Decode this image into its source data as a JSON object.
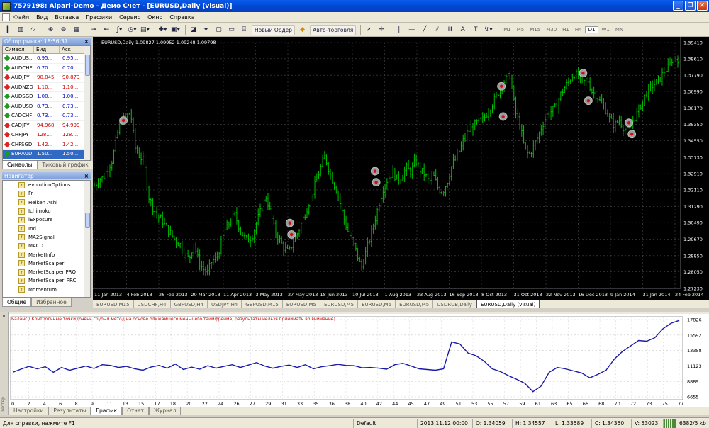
{
  "window": {
    "title": "7579198: Alpari-Demo - Демо Счет - [EURUSD,Daily (visual)]",
    "buttons": [
      "_",
      "❐",
      "✕"
    ]
  },
  "menu": [
    "Файл",
    "Вид",
    "Вставка",
    "Графики",
    "Сервис",
    "Окно",
    "Справка"
  ],
  "toolbar": {
    "new_order": "Новый Ордер",
    "auto_trading": "Авто-торговля",
    "timeframes": [
      "M1",
      "M5",
      "M15",
      "M30",
      "H1",
      "H4",
      "D1",
      "W1",
      "MN"
    ],
    "active_timeframe": "D1",
    "icons": [
      "bar-chart-icon",
      "candle-chart-icon",
      "line-chart-icon",
      "zoom-in-icon",
      "zoom-out-icon",
      "tile-icon",
      "autoscroll-icon",
      "shift-icon",
      "indicators-icon",
      "periods-icon",
      "templates-icon",
      "new-chart-icon",
      "profiles-icon",
      "market-watch-icon",
      "navigator-icon",
      "data-window-icon",
      "terminal-icon",
      "tester-icon"
    ]
  },
  "market_watch": {
    "title": "Обзор рынка: 18:56:37",
    "columns": [
      "Символ",
      "Бид",
      "Аск"
    ],
    "rows": [
      {
        "symbol": "AUDUS...",
        "bid": "0.95...",
        "ask": "0.95...",
        "dir": "up"
      },
      {
        "symbol": "AUDCHF",
        "bid": "0.70...",
        "ask": "0.70...",
        "dir": "up"
      },
      {
        "symbol": "AUDJPY",
        "bid": "90.845",
        "ask": "90.873",
        "dir": "down"
      },
      {
        "symbol": "AUDNZD",
        "bid": "1.10...",
        "ask": "1.10...",
        "dir": "down"
      },
      {
        "symbol": "AUDSGD",
        "bid": "1.00...",
        "ask": "1.00...",
        "dir": "up"
      },
      {
        "symbol": "AUDUSD",
        "bid": "0.73...",
        "ask": "0.73...",
        "dir": "up"
      },
      {
        "symbol": "CADCHF",
        "bid": "0.73...",
        "ask": "0.73...",
        "dir": "up"
      },
      {
        "symbol": "CADJPY",
        "bid": "94.968",
        "ask": "94.999",
        "dir": "down"
      },
      {
        "symbol": "CHFJPY",
        "bid": "128....",
        "ask": "128....",
        "dir": "down"
      },
      {
        "symbol": "CHFSGD",
        "bid": "1.42...",
        "ask": "1.42...",
        "dir": "down"
      },
      {
        "symbol": "EURAUD",
        "bid": "1.50...",
        "ask": "1.50...",
        "dir": "up",
        "selected": true
      }
    ],
    "tabs": [
      "Символы",
      "Тиковый график"
    ]
  },
  "navigator": {
    "title": "Навигатор",
    "items": [
      "evolutionOptions",
      "Fr",
      "Heiken Ashi",
      "Ichimoku",
      "iExposure",
      "Ind",
      "MA2Signal",
      "MACD",
      "MarketInfo",
      "MarketScalper",
      "MarketScalper PRO",
      "MarketScalper_PRC",
      "Momentum"
    ],
    "tabs": [
      "Общие",
      "Избранное"
    ]
  },
  "chart": {
    "header": "EURUSD,Daily  1.09827 1.09952 1.09248 1.09798",
    "price_labels": [
      "1.39410",
      "1.38610",
      "1.37790",
      "1.36990",
      "1.36170",
      "1.35350",
      "1.34550",
      "1.33730",
      "1.32910",
      "1.32110",
      "1.31290",
      "1.30490",
      "1.29670",
      "1.28850",
      "1.28050",
      "1.27230"
    ],
    "date_labels": [
      "11 Jan 2013",
      "4 Feb 2013",
      "26 Feb 2013",
      "20 Mar 2013",
      "11 Apr 2013",
      "3 May 2013",
      "27 May 2013",
      "18 Jun 2013",
      "10 Jul 2013",
      "1 Aug 2013",
      "23 Aug 2013",
      "16 Sep 2013",
      "8 Oct 2013",
      "31 Oct 2013",
      "22 Nov 2013",
      "16 Dec 2013",
      "9 Jan 2014",
      "31 Jan 2014",
      "24 Feb 2014"
    ],
    "candle_color": "#00c000",
    "grid_color": "#4a4a4a",
    "close_series": [
      1.323,
      1.3265,
      1.327,
      1.332,
      1.336,
      1.348,
      1.356,
      1.357,
      1.36,
      1.342,
      1.338,
      1.335,
      1.318,
      1.312,
      1.308,
      1.306,
      1.302,
      1.299,
      1.296,
      1.294,
      1.289,
      1.287,
      1.295,
      1.286,
      1.282,
      1.28,
      1.286,
      1.287,
      1.294,
      1.302,
      1.305,
      1.309,
      1.303,
      1.298,
      1.296,
      1.299,
      1.306,
      1.312,
      1.318,
      1.309,
      1.3,
      1.296,
      1.292,
      1.29,
      1.296,
      1.3,
      1.306,
      1.312,
      1.318,
      1.325,
      1.332,
      1.338,
      1.33,
      1.324,
      1.318,
      1.308,
      1.301,
      1.296,
      1.29,
      1.282,
      1.29,
      1.298,
      1.306,
      1.315,
      1.323,
      1.327,
      1.33,
      1.326,
      1.328,
      1.332,
      1.33,
      1.336,
      1.331,
      1.329,
      1.325,
      1.328,
      1.322,
      1.32,
      1.325,
      1.333,
      1.337,
      1.342,
      1.348,
      1.351,
      1.353,
      1.355,
      1.356,
      1.36,
      1.364,
      1.368,
      1.373,
      1.376,
      1.378,
      1.36,
      1.354,
      1.343,
      1.338,
      1.342,
      1.347,
      1.353,
      1.358,
      1.36,
      1.362,
      1.368,
      1.372,
      1.375,
      1.379,
      1.377,
      1.374,
      1.376,
      1.37,
      1.368,
      1.364,
      1.361,
      1.356,
      1.353,
      1.356,
      1.352,
      1.35,
      1.355,
      1.359,
      1.364,
      1.369,
      1.372,
      1.374,
      1.376,
      1.38,
      1.382,
      1.387,
      1.386
    ],
    "markers": [
      [
        0.07,
        0.33
      ],
      [
        0.085,
        0.31
      ],
      [
        0.525,
        0.49
      ],
      [
        0.53,
        0.45
      ],
      [
        0.66,
        0.68
      ],
      [
        0.668,
        0.69
      ],
      [
        0.85,
        0.8
      ],
      [
        0.855,
        0.72
      ],
      [
        0.933,
        0.4
      ],
      [
        0.955,
        0.3
      ],
      [
        0.96,
        0.32
      ],
      [
        1.25,
        0.2
      ]
    ]
  },
  "symbol_tabs": [
    "EURUSD,M15",
    "USDCHF,H4",
    "GBPUSD,H4",
    "USDJPY,H4",
    "GBPUSD,M15",
    "EURUSD,M5",
    "EURUSD,M5",
    "EURUSD,M5",
    "EURUSD,M5",
    "USDRUB,Daily",
    "EURUSD,Daily (visual)"
  ],
  "active_symbol_tab": "EURUSD,Daily (visual)",
  "tester": {
    "side_label": "Тестер",
    "legend": "Баланс / Контрольные точки (очень грубый метод на основе ближайшего меньшего таймфрейма, результаты нельзя принимать во внимание)",
    "y_labels": [
      "17826",
      "15592",
      "13358",
      "11123",
      "8889",
      "6655"
    ],
    "x_labels": [
      "0",
      "2",
      "4",
      "6",
      "8",
      "9",
      "11",
      "13",
      "15",
      "17",
      "18",
      "20",
      "22",
      "24",
      "26",
      "27",
      "29",
      "31",
      "33",
      "35",
      "36",
      "38",
      "40",
      "42",
      "44",
      "45",
      "47",
      "49",
      "51",
      "53",
      "55",
      "57",
      "59",
      "61",
      "63",
      "65",
      "66",
      "68",
      "70",
      "72",
      "73",
      "75",
      "77"
    ],
    "line_color": "#1a1aa8",
    "balance_series": [
      10200,
      10650,
      11050,
      10700,
      11000,
      10200,
      10900,
      10500,
      10800,
      11100,
      10750,
      11300,
      11200,
      10900,
      11050,
      10700,
      10500,
      10950,
      11200,
      10800,
      11400,
      10600,
      10950,
      10650,
      11150,
      10800,
      11050,
      11300,
      10900,
      11250,
      11600,
      11100,
      10800,
      11050,
      11250,
      10900,
      11300,
      10700,
      11000,
      11150,
      11350,
      11200,
      11150,
      10850,
      10900,
      10800,
      10650,
      11300,
      11500,
      11100,
      10700,
      10600,
      10500,
      10700,
      14600,
      14300,
      13000,
      12600,
      11800,
      10700,
      10300,
      9700,
      9200,
      8600,
      7400,
      8200,
      10200,
      10900,
      10700,
      10400,
      10100,
      9400,
      9900,
      10500,
      12100,
      13200,
      14000,
      14800,
      14700,
      15200,
      16500,
      17300,
      17700
    ],
    "tabs": [
      "Настройки",
      "Результаты",
      "График",
      "Отчет",
      "Журнал"
    ],
    "active_tab": "График"
  },
  "status": {
    "help": "Для справки, нажмите F1",
    "profile": "Default",
    "datetime": "2013.11.12 00:00",
    "open": "O: 1.34059",
    "high": "H: 1.34557",
    "low": "L: 1.33589",
    "close": "C: 1.34350",
    "volume": "V: 53023",
    "traffic": "6382/5 kb"
  }
}
